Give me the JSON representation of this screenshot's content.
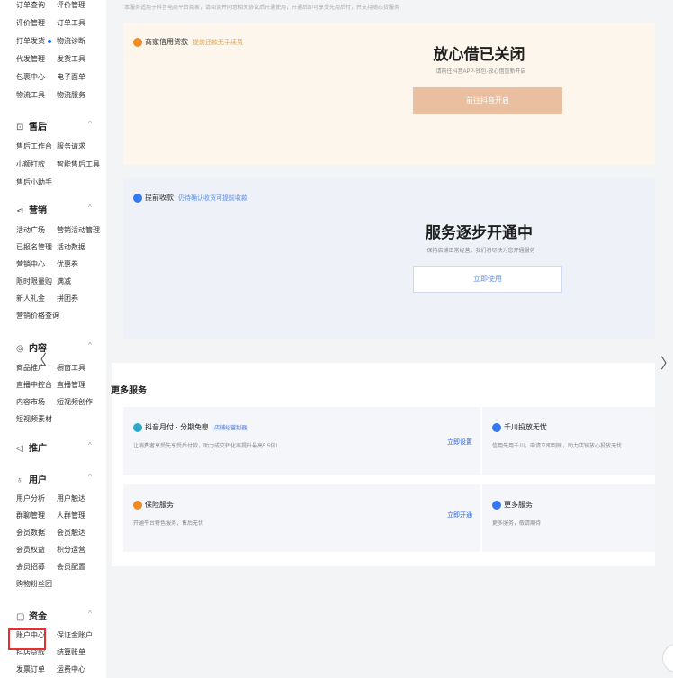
{
  "top_note": "本服务适用于抖音电商平台商家，请阅读并同意相关协议后开通使用，开通后即可享受先用后付，并支持随心贷服务",
  "sidebar": {
    "rows": [
      {
        "a": "订单查询",
        "b": "评价管理"
      },
      {
        "a": "评价管理",
        "b": "订单工具"
      },
      {
        "a": "打单发货",
        "b": "物流诊断",
        "dot": true
      },
      {
        "a": "代发管理",
        "b": "发货工具"
      },
      {
        "a": "包裹中心",
        "b": "电子面单"
      },
      {
        "a": "物流工具",
        "b": "物流服务"
      }
    ],
    "sec_after": {
      "icon": "⊡",
      "label": "售后"
    },
    "rows2": [
      {
        "a": "售后工作台",
        "b": "服务请求"
      },
      {
        "a": "小额打款",
        "b": "智能售后工具"
      },
      {
        "a": "售后小助手",
        "b": ""
      }
    ],
    "sec_marketing": {
      "icon": "⊲",
      "label": "营销"
    },
    "rows3": [
      {
        "a": "活动广场",
        "b": "营销活动管理"
      },
      {
        "a": "已报名管理",
        "b": "活动数据"
      },
      {
        "a": "营销中心",
        "b": "优惠券"
      },
      {
        "a": "限时限量购",
        "b": "满减"
      },
      {
        "a": "新人礼金",
        "b": "拼团券"
      },
      {
        "a": "营销价格查询",
        "b": ""
      }
    ],
    "sec_content": {
      "icon": "◎",
      "label": "内容"
    },
    "rows4": [
      {
        "a": "商品推广",
        "b": "橱窗工具"
      },
      {
        "a": "直播中控台",
        "b": "直播管理"
      },
      {
        "a": "内容市场",
        "b": "短视频创作"
      },
      {
        "a": "短视频素材",
        "b": ""
      }
    ],
    "sec_ads": {
      "icon": "◁",
      "label": "推广"
    },
    "sec_user": {
      "icon": "♁",
      "label": "用户"
    },
    "rows5": [
      {
        "a": "用户分析",
        "b": "用户触达"
      },
      {
        "a": "群聊管理",
        "b": "人群管理"
      },
      {
        "a": "会员数据",
        "b": "会员触达"
      },
      {
        "a": "会员权益",
        "b": "积分运营"
      },
      {
        "a": "会员招募",
        "b": "会员配置"
      },
      {
        "a": "购物粉丝团",
        "b": ""
      }
    ],
    "sec_fund": {
      "icon": "▢",
      "label": "资金"
    },
    "rows6": [
      {
        "a": "账户中心",
        "b": "保证金账户"
      },
      {
        "a": "抖店贷款",
        "b": "结算账单"
      },
      {
        "a": "发票订单",
        "b": "运费中心"
      }
    ],
    "chevron": "^"
  },
  "card1": {
    "title": "商家信用贷款",
    "tag": "提前还款无手续费",
    "heading": "放心借已关闭",
    "subtitle": "请前往抖音APP-钱包-放心借重新开启",
    "button": "前往抖音开启",
    "icon_color": "#f08a24"
  },
  "card2": {
    "title": "提前收款",
    "tag": "仍待确认收货可提前收款",
    "heading": "服务逐步开通中",
    "subtitle": "保持店铺正常经营，我们将尽快为您开通服务",
    "button": "立即使用",
    "icon_color": "#3478f6"
  },
  "more": {
    "title": "更多服务",
    "items": [
      {
        "title": "抖音月付 · 分期免息",
        "badge": "店铺经营利器",
        "desc": "让消费者享受先享受后付款，助力成交转化率提升最高5.5倍!",
        "action": "立即设置",
        "icon_color": "#2aa7c9"
      },
      {
        "title": "千川投放无忧",
        "badge": "",
        "desc": "信用先用千川，申请立即到账，助力店铺放心投放无忧",
        "action": "",
        "icon_color": "#3478f6"
      },
      {
        "title": "保险服务",
        "badge": "",
        "desc": "开通平台特色服务，售后无忧",
        "action": "立即开通",
        "icon_color": "#f08a24"
      },
      {
        "title": "更多服务",
        "badge": "",
        "desc": "更多服务，敬请期待",
        "action": "",
        "icon_color": "#3478f6"
      }
    ]
  },
  "nav": {
    "prev": "〈",
    "next": "〉"
  }
}
